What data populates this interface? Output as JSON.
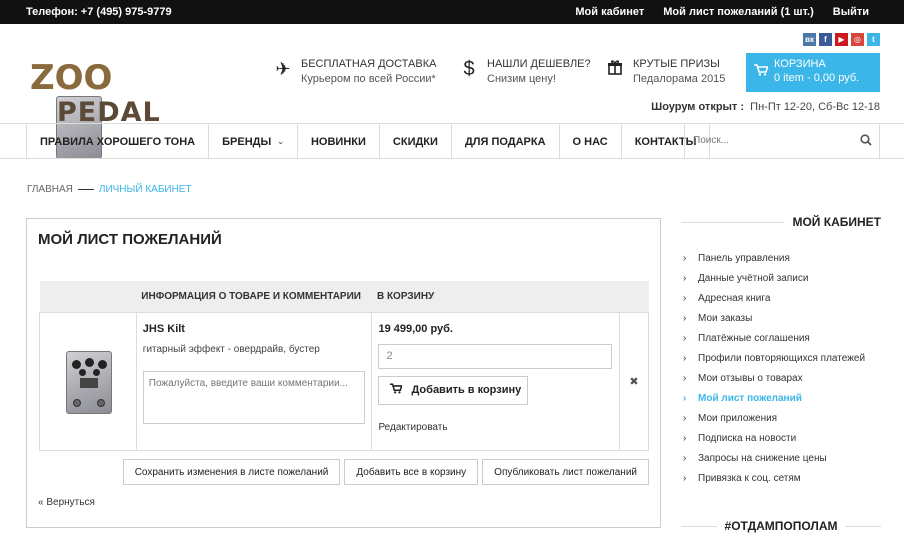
{
  "topbar": {
    "phone": "Телефон:  +7 (495) 975-9779",
    "links": [
      "Мой кабинет",
      "Мой лист пожеланий (1 шт.)",
      "Выйти"
    ]
  },
  "social": [
    {
      "icon": "vk-icon",
      "glyph": "вк",
      "color": "#4a76a8"
    },
    {
      "icon": "facebook-icon",
      "glyph": "f",
      "color": "#3b5998"
    },
    {
      "icon": "youtube-icon",
      "glyph": "▶",
      "color": "#cc181e"
    },
    {
      "icon": "instagram-icon",
      "glyph": "◎",
      "color": "#d8453b"
    },
    {
      "icon": "twitter-icon",
      "glyph": "t",
      "color": "#3bb6e8"
    }
  ],
  "logo": {
    "part1": "PEDAL ",
    "part2": "ZOO"
  },
  "features": [
    {
      "icon": "plane-icon",
      "glyph": "✈",
      "title": "Бесплатная доставка",
      "sub": "Курьером по всей России*"
    },
    {
      "icon": "dollar-icon",
      "glyph": "$",
      "title": "Нашли дешевле?",
      "sub": "Снизим цену!"
    },
    {
      "icon": "gift-icon",
      "glyph": "🎁",
      "title": "Крутые призы",
      "sub": "Педалорама 2015"
    }
  ],
  "cart": {
    "title": "Корзина",
    "summary": "0 item - 0,00 руб.",
    "accent": "#3bb6e8"
  },
  "showroom": {
    "label": "Шоурум открыт :",
    "hours": "Пн-Пт 12-20, Сб-Вс 12-18"
  },
  "nav": {
    "items": [
      "Правила хорошего тона",
      "Бренды",
      "Новинки",
      "Скидки",
      "Для подарка",
      "О нас",
      "Контакты"
    ],
    "search_placeholder": "Поиск..."
  },
  "breadcrumb": {
    "home": "Главная",
    "current": "Личный кабинет"
  },
  "wishlist": {
    "title": "Мой лист пожеланий",
    "columns": [
      "",
      "Информация о товаре и комментарии",
      "В корзину",
      ""
    ],
    "item": {
      "name": "JHS Kilt",
      "description": "гитарный эффект - овердрайв, бустер",
      "comment_placeholder": "Пожалуйста, введите ваши комментарии...",
      "price": "19 499,00 руб.",
      "qty": "2",
      "add_to_cart": "Добавить в корзину",
      "edit": "Редактировать",
      "remove": "✖"
    },
    "actions": [
      "Сохранить изменения в листе пожеланий",
      "Добавить все в корзину",
      "Опубликовать лист пожеланий"
    ],
    "back": "« Вернуться"
  },
  "sidebar": {
    "title": "Мой кабинет",
    "items": [
      "Панель управления",
      "Данные учётной записи",
      "Адресная книга",
      "Мои заказы",
      "Платёжные соглашения",
      "Профили повторяющихся платежей",
      "Мои отзывы о товарах",
      "Мой лист пожеланий",
      "Мои приложения",
      "Подписка на новости",
      "Запросы на снижение цены",
      "Привязка к соц. сетям"
    ],
    "active_index": 7,
    "title2": "#ОТДАМПОПОЛАМ"
  }
}
